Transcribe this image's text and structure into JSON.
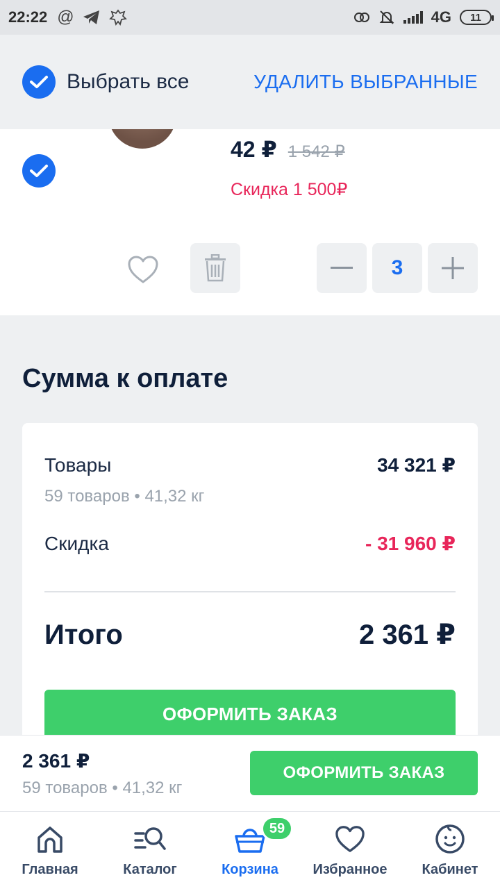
{
  "status_bar": {
    "time": "22:22",
    "network": "4G",
    "battery": "11"
  },
  "header": {
    "select_all_label": "Выбрать все",
    "delete_selected_label": "УДАЛИТЬ ВЫБРАННЫЕ"
  },
  "product": {
    "price": "42 ₽",
    "old_price": "1 542 ₽",
    "discount": "Скидка 1 500₽",
    "quantity": "3"
  },
  "summary": {
    "title": "Сумма к оплате",
    "goods_label": "Товары",
    "goods_value": "34 321 ₽",
    "goods_meta": "59 товаров • 41,32 кг",
    "discount_label": "Скидка",
    "discount_value": "- 31 960 ₽",
    "total_label": "Итого",
    "total_value": "2 361 ₽",
    "checkout_label": "ОФОРМИТЬ ЗАКАЗ"
  },
  "order_bar": {
    "total": "2 361 ₽",
    "meta": "59 товаров • 41,32 кг",
    "checkout_label": "ОФОРМИТЬ ЗАКАЗ"
  },
  "bottom_nav": {
    "items": [
      {
        "label": "Главная",
        "icon": "home-icon"
      },
      {
        "label": "Каталог",
        "icon": "catalog-search-icon"
      },
      {
        "label": "Корзина",
        "icon": "basket-icon",
        "badge": "59"
      },
      {
        "label": "Избранное",
        "icon": "heart-icon"
      },
      {
        "label": "Кабинет",
        "icon": "profile-icon"
      }
    ],
    "active_index": 2
  },
  "colors": {
    "accent_blue": "#1a6df0",
    "accent_green": "#3ecf6b",
    "discount_red": "#e8265a"
  }
}
